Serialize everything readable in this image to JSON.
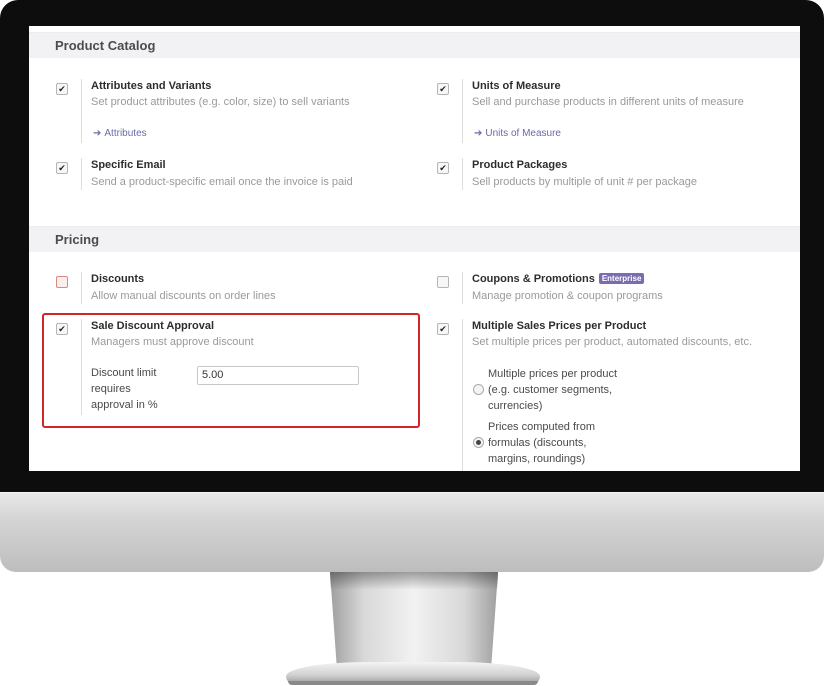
{
  "product_catalog": {
    "header": "Product Catalog",
    "attributes": {
      "title": "Attributes and Variants",
      "description": "Set product attributes (e.g. color, size) to sell variants",
      "link": "Attributes",
      "checked": true
    },
    "uom": {
      "title": "Units of Measure",
      "description": "Sell and purchase products in different units of measure",
      "link": "Units of Measure",
      "checked": true
    },
    "specific_email": {
      "title": "Specific Email",
      "description": "Send a product-specific email once the invoice is paid",
      "checked": true
    },
    "packages": {
      "title": "Product Packages",
      "description": "Sell products by multiple of unit # per package",
      "checked": true
    }
  },
  "pricing": {
    "header": "Pricing",
    "discounts": {
      "title": "Discounts",
      "description": "Allow manual discounts on order lines",
      "checked": false
    },
    "coupons": {
      "title": "Coupons & Promotions",
      "badge": "Enterprise",
      "description": "Manage promotion & coupon programs",
      "checked": false
    },
    "sale_discount_approval": {
      "title": "Sale Discount Approval",
      "description": "Managers must approve discount",
      "checked": true,
      "field_label_1": "Discount limit",
      "field_label_2": "requires",
      "field_label_3": "approval in %",
      "field_value": "5.00"
    },
    "multiple_prices": {
      "title": "Multiple Sales Prices per Product",
      "description": "Set multiple prices per product, automated discounts, etc.",
      "checked": true,
      "option_1": {
        "line_1": "Multiple prices per product",
        "line_2": "(e.g. customer segments,",
        "line_3": "currencies)",
        "selected": false
      },
      "option_2": {
        "line_1": "Prices computed from",
        "line_2": "formulas (discounts,",
        "line_3": "margins, roundings)",
        "selected": true
      }
    }
  },
  "colors": {
    "highlight": "#d3242b",
    "link": "#6a6aa8",
    "badge": "#7c6bb0"
  }
}
